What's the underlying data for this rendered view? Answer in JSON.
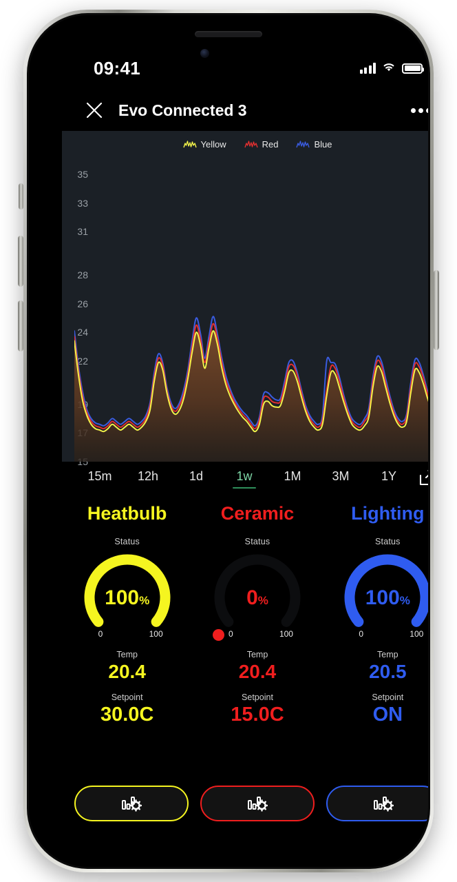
{
  "status_bar": {
    "time": "09:41",
    "signal_icon": "cellular-bars-icon",
    "wifi_icon": "wifi-icon",
    "battery_icon": "battery-full-icon"
  },
  "nav": {
    "close_icon": "close-icon",
    "title": "Evo Connected 3",
    "more_icon": "more-options-icon"
  },
  "chart_data": {
    "type": "line",
    "title": "",
    "xlabel": "",
    "ylabel": "",
    "ylim": [
      15,
      36
    ],
    "grid": false,
    "legend_position": "top-center",
    "ytick_labels": [
      "35",
      "33",
      "31",
      "28",
      "26",
      "24",
      "22",
      "19",
      "17",
      "15"
    ],
    "ytick_values": [
      35,
      33,
      31,
      28,
      26,
      24,
      22,
      19,
      17,
      15
    ],
    "fill": "area-below-gradient",
    "fill_color": "#7a4a2a",
    "legend": [
      {
        "name": "Yellow",
        "color": "#f2f24a",
        "icon": "spark-line-icon"
      },
      {
        "name": "Red",
        "color": "#e03030",
        "icon": "spark-line-icon"
      },
      {
        "name": "Blue",
        "color": "#3a5ce0",
        "icon": "spark-line-icon"
      }
    ],
    "series": [
      {
        "name": "Yellow",
        "color": "#f2f24a",
        "values": [
          23.4,
          21.0,
          19.2,
          18.2,
          17.6,
          17.3,
          17.2,
          17.1,
          17.3,
          17.6,
          17.4,
          17.2,
          17.4,
          17.6,
          17.4,
          17.2,
          17.4,
          17.8,
          18.6,
          20.6,
          21.9,
          21.4,
          19.8,
          18.7,
          18.3,
          18.6,
          19.4,
          20.8,
          22.6,
          24.0,
          23.1,
          21.5,
          22.9,
          24.1,
          23.2,
          21.6,
          20.4,
          19.6,
          19.0,
          18.5,
          18.1,
          17.8,
          17.4,
          17.1,
          17.6,
          19.0,
          19.2,
          18.9,
          18.8,
          18.9,
          19.9,
          21.2,
          21.3,
          20.6,
          19.5,
          18.5,
          17.8,
          17.4,
          17.2,
          17.6,
          19.6,
          21.2,
          21.1,
          20.2,
          19.2,
          18.3,
          17.6,
          17.3,
          17.2,
          17.5,
          18.1,
          20.2,
          21.6,
          21.3,
          20.2,
          19.1,
          18.2,
          17.6,
          17.4,
          17.8,
          19.8,
          21.4,
          21.2,
          20.4,
          19.4,
          18.6,
          18.0,
          17.7,
          18.2,
          20.2,
          21.5
        ]
      },
      {
        "name": "Red",
        "color": "#e03030",
        "values": [
          23.7,
          21.3,
          19.5,
          18.4,
          17.8,
          17.5,
          17.4,
          17.3,
          17.5,
          17.8,
          17.6,
          17.4,
          17.6,
          17.8,
          17.6,
          17.4,
          17.6,
          18.0,
          18.9,
          20.9,
          22.2,
          21.7,
          20.0,
          18.9,
          18.5,
          18.9,
          19.7,
          21.1,
          23.0,
          24.5,
          23.5,
          21.9,
          23.3,
          24.6,
          23.6,
          22.0,
          20.7,
          19.9,
          19.2,
          18.7,
          18.3,
          18.0,
          17.6,
          17.3,
          17.9,
          19.4,
          19.5,
          19.2,
          19.1,
          19.2,
          20.3,
          21.6,
          21.7,
          21.0,
          19.8,
          18.7,
          18.0,
          17.6,
          17.4,
          17.9,
          20.0,
          21.6,
          21.5,
          20.6,
          19.5,
          18.5,
          17.8,
          17.5,
          17.4,
          17.8,
          18.4,
          20.6,
          22.0,
          21.7,
          20.5,
          19.4,
          18.4,
          17.8,
          17.6,
          18.1,
          20.2,
          21.8,
          21.6,
          20.8,
          19.7,
          18.8,
          18.2,
          17.9,
          18.5,
          20.6,
          21.9
        ]
      },
      {
        "name": "Blue",
        "color": "#3a5ce0",
        "values": [
          24.1,
          21.6,
          19.8,
          18.6,
          18.0,
          17.7,
          17.6,
          17.5,
          17.7,
          18.0,
          17.8,
          17.6,
          17.8,
          18.0,
          17.8,
          17.6,
          17.8,
          18.2,
          19.1,
          21.2,
          22.5,
          21.9,
          20.2,
          19.1,
          18.7,
          19.1,
          20.0,
          21.4,
          23.4,
          25.0,
          23.9,
          22.2,
          23.7,
          25.1,
          23.9,
          22.3,
          21.0,
          20.1,
          19.4,
          18.9,
          18.5,
          18.2,
          17.8,
          17.5,
          18.1,
          19.7,
          19.8,
          19.5,
          19.3,
          19.4,
          20.6,
          21.9,
          22.0,
          21.2,
          20.0,
          18.9,
          18.2,
          17.8,
          17.6,
          18.2,
          22.0,
          21.9,
          21.8,
          20.9,
          19.7,
          18.7,
          18.0,
          17.7,
          17.6,
          18.0,
          18.7,
          20.9,
          22.3,
          22.0,
          20.8,
          19.6,
          18.6,
          18.0,
          17.8,
          18.3,
          20.5,
          22.1,
          21.9,
          21.0,
          19.9,
          19.0,
          18.4,
          18.1,
          18.8,
          20.9,
          22.2
        ]
      }
    ]
  },
  "ranges": {
    "items": [
      {
        "label": "15m",
        "active": false
      },
      {
        "label": "12h",
        "active": false
      },
      {
        "label": "1d",
        "active": false
      },
      {
        "label": "1w",
        "active": true
      },
      {
        "label": "1M",
        "active": false
      },
      {
        "label": "3M",
        "active": false
      },
      {
        "label": "1Y",
        "active": false
      }
    ],
    "export_icon": "export-share-icon",
    "active_color": "#7fd8a8"
  },
  "devices": [
    {
      "name": "Heatbulb",
      "color": "#f5f520",
      "status_label": "Status",
      "status_value": "100",
      "status_unit": "%",
      "gauge_percent": 100,
      "scale_min": "0",
      "scale_max": "100",
      "temp_label": "Temp",
      "temp_value": "20.4",
      "setpoint_label": "Setpoint",
      "setpoint_value": "30.0C",
      "action_icon": "chart-settings-icon"
    },
    {
      "name": "Ceramic",
      "color": "#f01e1e",
      "status_label": "Status",
      "status_value": "0",
      "status_unit": "%",
      "gauge_percent": 0,
      "scale_min": "0",
      "scale_max": "100",
      "temp_label": "Temp",
      "temp_value": "20.4",
      "setpoint_label": "Setpoint",
      "setpoint_value": "15.0C",
      "action_icon": "chart-settings-icon"
    },
    {
      "name": "Lighting",
      "color": "#2f5cf0",
      "status_label": "Status",
      "status_value": "100",
      "status_unit": "%",
      "gauge_percent": 100,
      "scale_min": "0",
      "scale_max": "100",
      "temp_label": "Temp",
      "temp_value": "20.5",
      "setpoint_label": "Setpoint",
      "setpoint_value": "ON",
      "action_icon": "chart-settings-icon"
    }
  ]
}
